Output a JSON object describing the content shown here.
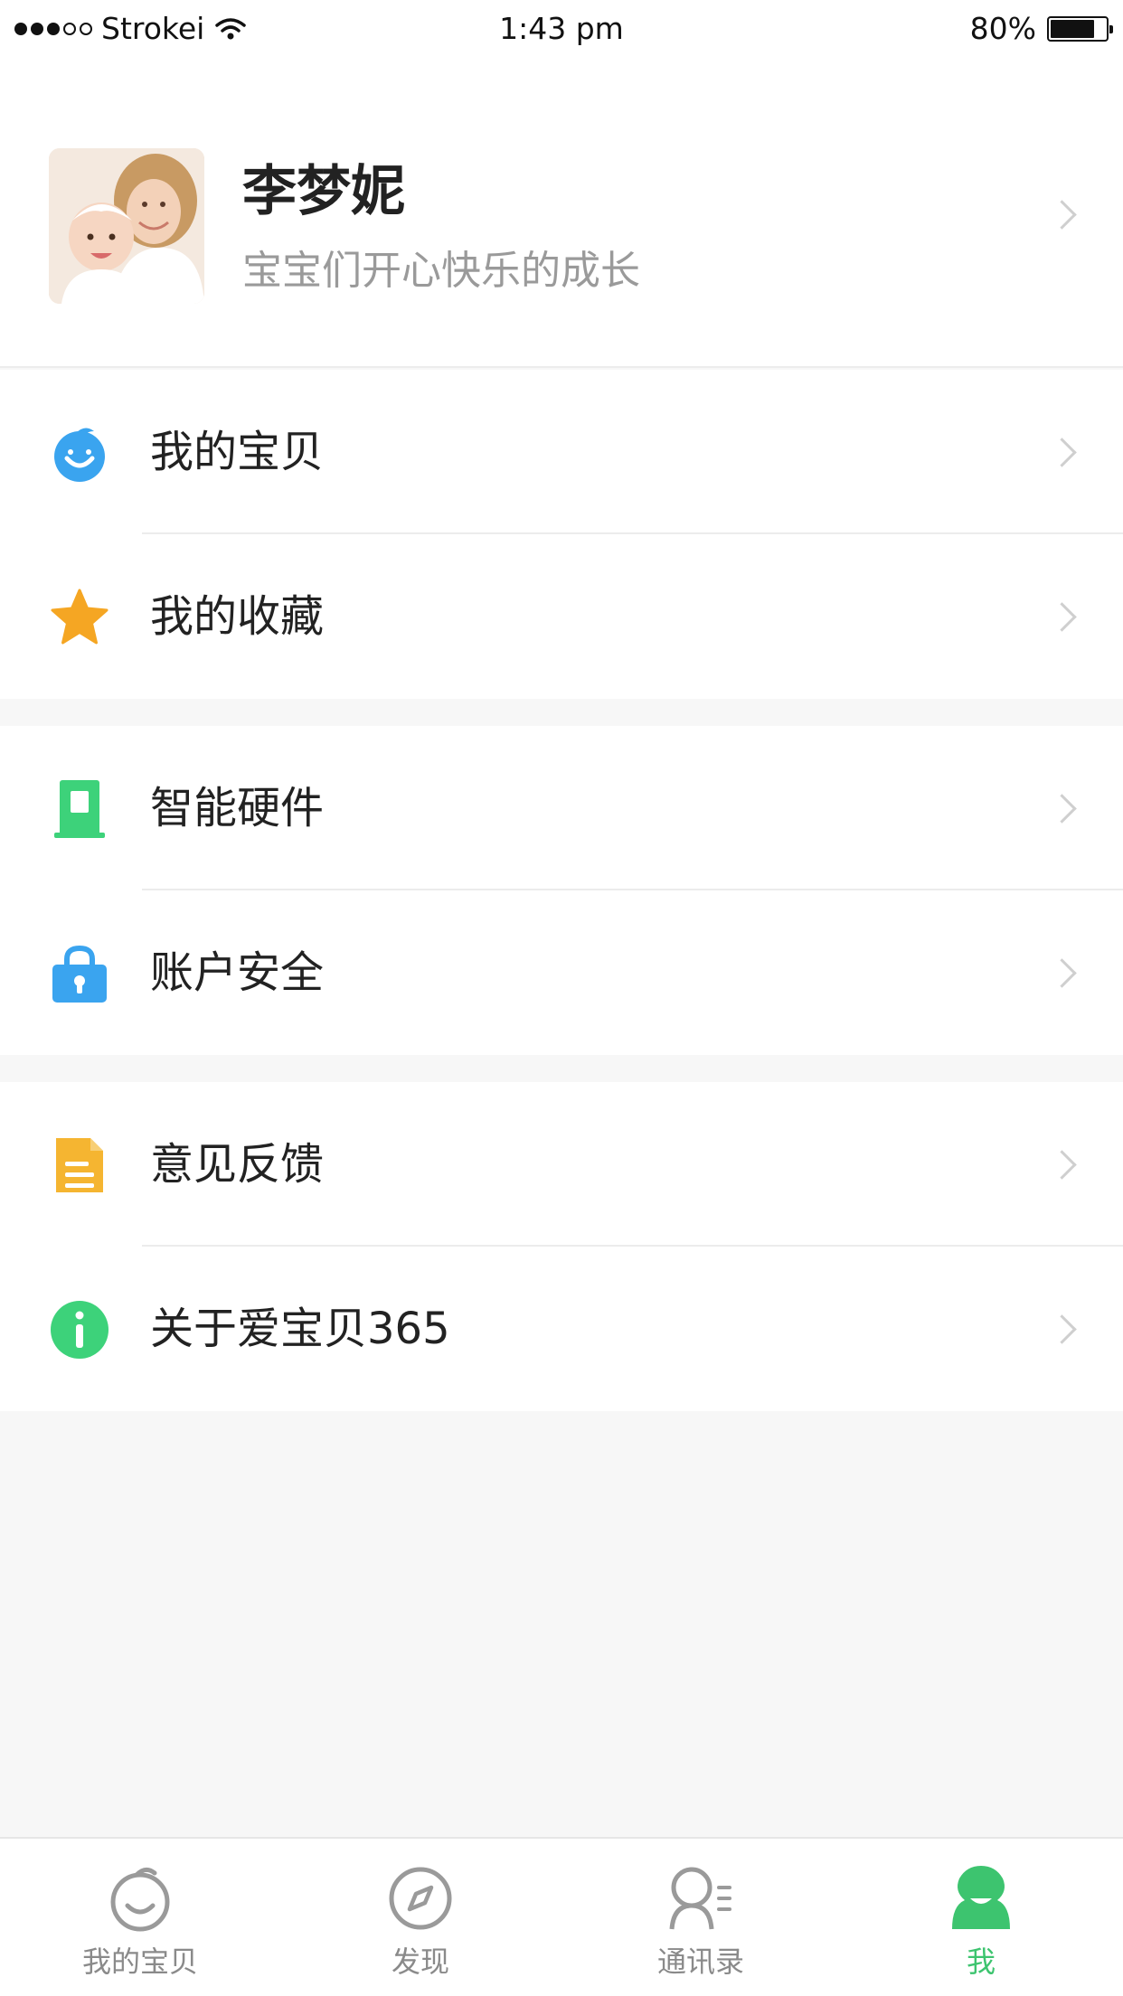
{
  "status_bar": {
    "carrier": "Strokei",
    "time": "1:43 pm",
    "battery": "80%",
    "battery_level": 0.8
  },
  "profile": {
    "name": "李梦妮",
    "subtitle": "宝宝们开心快乐的成长"
  },
  "groups": [
    {
      "items": [
        {
          "label": "我的宝贝",
          "icon": "baby-face-icon",
          "color": "#3aa4ef"
        },
        {
          "label": "我的收藏",
          "icon": "star-icon",
          "color": "#f5a623"
        }
      ]
    },
    {
      "items": [
        {
          "label": "智能硬件",
          "icon": "device-icon",
          "color": "#3dd27a"
        },
        {
          "label": "账户安全",
          "icon": "lock-icon",
          "color": "#3aa4ef"
        }
      ]
    },
    {
      "items": [
        {
          "label": "意见反馈",
          "icon": "document-icon",
          "color": "#f5b531"
        },
        {
          "label": "关于爱宝贝365",
          "icon": "info-icon",
          "color": "#3dd27a"
        }
      ]
    }
  ],
  "tab_bar": {
    "tabs": [
      {
        "label": "我的宝贝",
        "icon": "baby-face-icon",
        "active": false
      },
      {
        "label": "发现",
        "icon": "compass-icon",
        "active": false
      },
      {
        "label": "通讯录",
        "icon": "contacts-icon",
        "active": false
      },
      {
        "label": "我",
        "icon": "person-icon",
        "active": true
      }
    ],
    "active_color": "#3dc46f",
    "inactive_color": "#8a8a8a"
  }
}
